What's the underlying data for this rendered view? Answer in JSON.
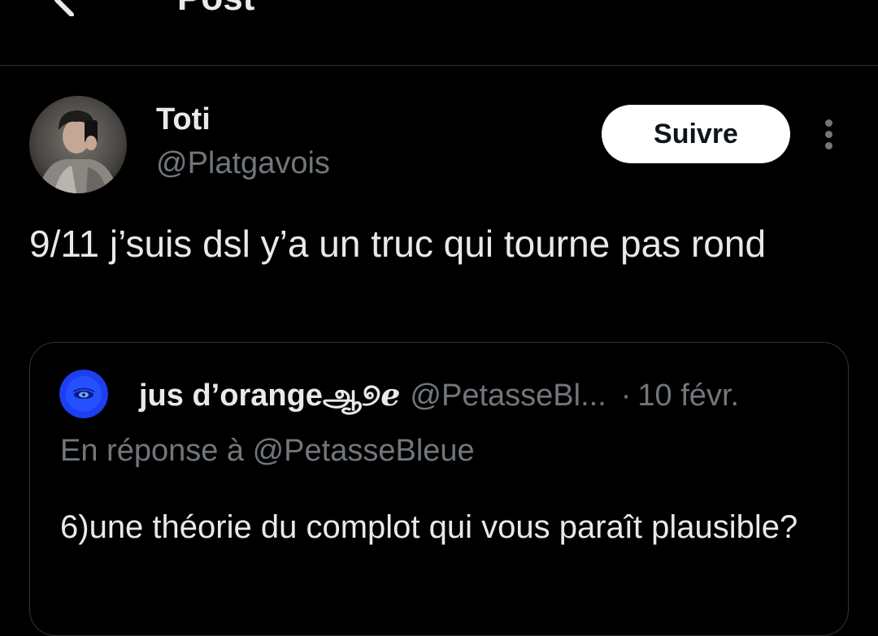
{
  "header": {
    "title": "Post",
    "back_icon": "back-arrow-icon"
  },
  "post": {
    "author": {
      "name": "Toti",
      "handle": "@Platgavois"
    },
    "follow_label": "Suivre",
    "more_icon": "more-vertical-icon",
    "text": "9/11 j’suis dsl y’a un truc qui tourne pas rond"
  },
  "quote": {
    "author_name": "jus d’orangeஆ୭ℯ",
    "handle": "@PetasseBl...",
    "separator": "·",
    "date": "10 févr.",
    "reply_to": "En réponse à @PetasseBleue",
    "text": "6)une théorie du complot qui vous paraît plausible?"
  },
  "colors": {
    "background": "#000000",
    "text_primary": "#e7e9ea",
    "text_secondary": "#71767b",
    "border": "#2f3336",
    "follow_button_bg": "#ffffff"
  }
}
